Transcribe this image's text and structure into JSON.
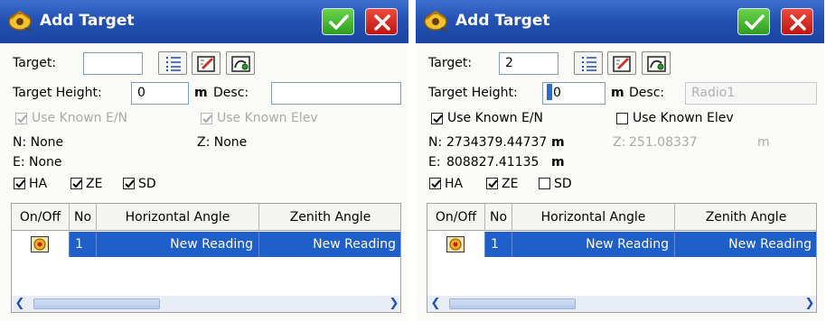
{
  "screens": {
    "left": {
      "title": "Add Target",
      "target_label": "Target:",
      "target_value": "",
      "target_height_label": "Target Height:",
      "target_height_value": "0",
      "unit_m": "m",
      "desc_label": "Desc:",
      "desc_value": "",
      "use_known_en": {
        "label": "Use Known E/N",
        "checked": true,
        "enabled": false
      },
      "use_known_elev": {
        "label": "Use Known Elev",
        "checked": true,
        "enabled": false
      },
      "n_line": "N: None",
      "e_line": "E: None",
      "z_line": "Z: None",
      "ha": {
        "label": "HA",
        "checked": true
      },
      "ze": {
        "label": "ZE",
        "checked": true
      },
      "sd": {
        "label": "SD",
        "checked": true
      },
      "table": {
        "headers": [
          "On/Off",
          "No",
          "Horizontal Angle",
          "Zenith Angle"
        ],
        "rows": [
          {
            "no": "1",
            "ha": "New Reading",
            "za": "New Reading"
          }
        ]
      }
    },
    "right": {
      "title": "Add Target",
      "target_label": "Target:",
      "target_value": "2",
      "target_height_label": "Target Height:",
      "target_height_value": "0",
      "unit_m": "m",
      "desc_label": "Desc:",
      "desc_value": "Radio1",
      "use_known_en": {
        "label": "Use Known E/N",
        "checked": true,
        "enabled": true
      },
      "use_known_elev": {
        "label": "Use Known Elev",
        "checked": false,
        "enabled": true
      },
      "n_label": "N:",
      "n_value": "2734379.44737",
      "e_label": "E:",
      "e_value": "808827.41135",
      "n_unit": "m",
      "e_unit": "m",
      "z_label": "Z:",
      "z_value": "251.08337",
      "z_unit": "m",
      "ha": {
        "label": "HA",
        "checked": true
      },
      "ze": {
        "label": "ZE",
        "checked": true
      },
      "sd": {
        "label": "SD",
        "checked": false
      },
      "table": {
        "headers": [
          "On/Off",
          "No",
          "Horizontal Angle",
          "Zenith Angle"
        ],
        "rows": [
          {
            "no": "1",
            "ha": "New Reading",
            "za": "New Reading"
          }
        ]
      }
    }
  },
  "colors": {
    "titlebar": "#2352b4",
    "ok_button": "#3fae2c",
    "close_button": "#d9241b",
    "selected_row": "#1f5fc9"
  },
  "icons": [
    "app-logo-icon",
    "checkmark-icon",
    "close-x-icon",
    "list-icon",
    "edit-note-icon",
    "map-point-icon",
    "target-toggle-icon",
    "scroll-left-icon",
    "scroll-right-icon"
  ]
}
